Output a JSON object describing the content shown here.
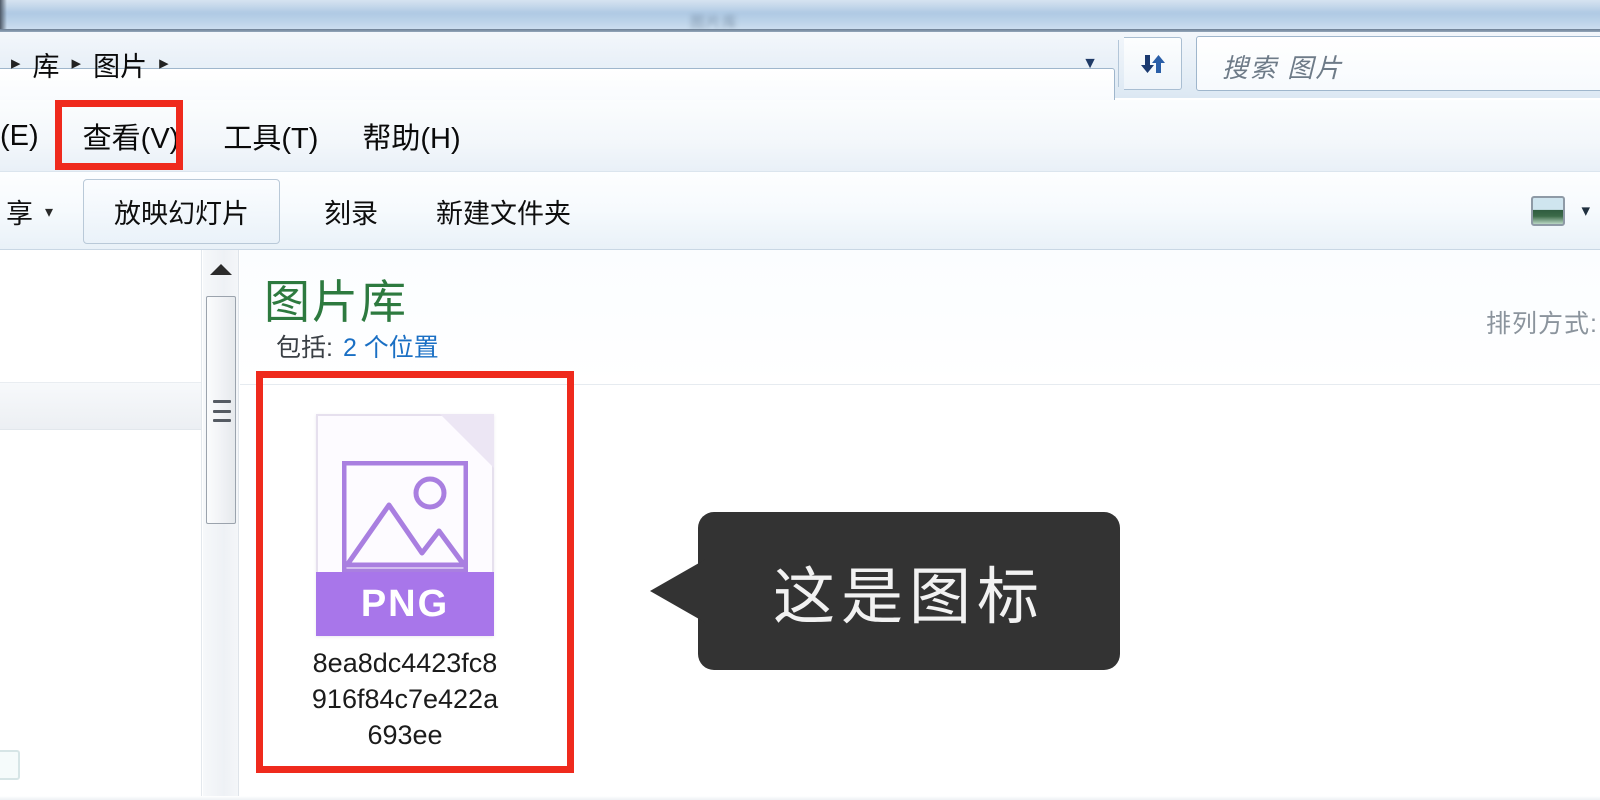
{
  "window": {
    "title_blurred": "图片库",
    "titlebar_color": "#b0cae4"
  },
  "address_bar": {
    "breadcrumb": {
      "leading_separator": "▸",
      "items": [
        {
          "label": "库",
          "separator": "▸"
        },
        {
          "label": "图片",
          "separator": "▸"
        }
      ]
    },
    "history_dropdown_icon": "chevron-down-icon",
    "refresh_icon": "refresh-icon",
    "search": {
      "placeholder": "搜索 图片",
      "value": ""
    }
  },
  "menu_bar": {
    "items": [
      {
        "label": "(E)",
        "highlighted": false
      },
      {
        "label": "查看(V)",
        "highlighted": true
      },
      {
        "label": "工具(T)",
        "highlighted": false
      },
      {
        "label": "帮助(H)",
        "highlighted": false
      }
    ]
  },
  "toolbar": {
    "share_label": "享",
    "share_caret": "▾",
    "slideshow_label": "放映幻灯片",
    "burn_label": "刻录",
    "new_folder_label": "新建文件夹",
    "view_mode_icon": "picture-view-icon",
    "view_mode_caret": "▾"
  },
  "content": {
    "library_title": "图片库",
    "library_title_color": "#2d7a3f",
    "includes_label": "包括:",
    "includes_link": "2 个位置",
    "includes_link_color": "#1a6fc4",
    "arrange_label": "排列方式:",
    "files": [
      {
        "name_lines": [
          "8ea8dc4423fc8",
          "916f84c7e422a",
          "693ee"
        ],
        "full_name": "8ea8dc4423fc8916f84c7e422a693ee",
        "type_badge": "PNG",
        "badge_color": "#a876ea",
        "icon": "png-file-icon"
      }
    ]
  },
  "scrollbar": {
    "up_arrow_icon": "scroll-up-arrow-icon",
    "grip_icon": "scrollbar-grip-icon"
  },
  "annotations": {
    "highlight_color": "#ef2a1d",
    "boxes": [
      {
        "target": "view-menu",
        "label": "查看(V)"
      },
      {
        "target": "png-file-tile",
        "label": "8ea8dc4423fc8916f84c7e422a693ee"
      }
    ],
    "callout": {
      "text": "这是图标",
      "background": "#333333",
      "text_color": "#f2f2f2"
    }
  }
}
